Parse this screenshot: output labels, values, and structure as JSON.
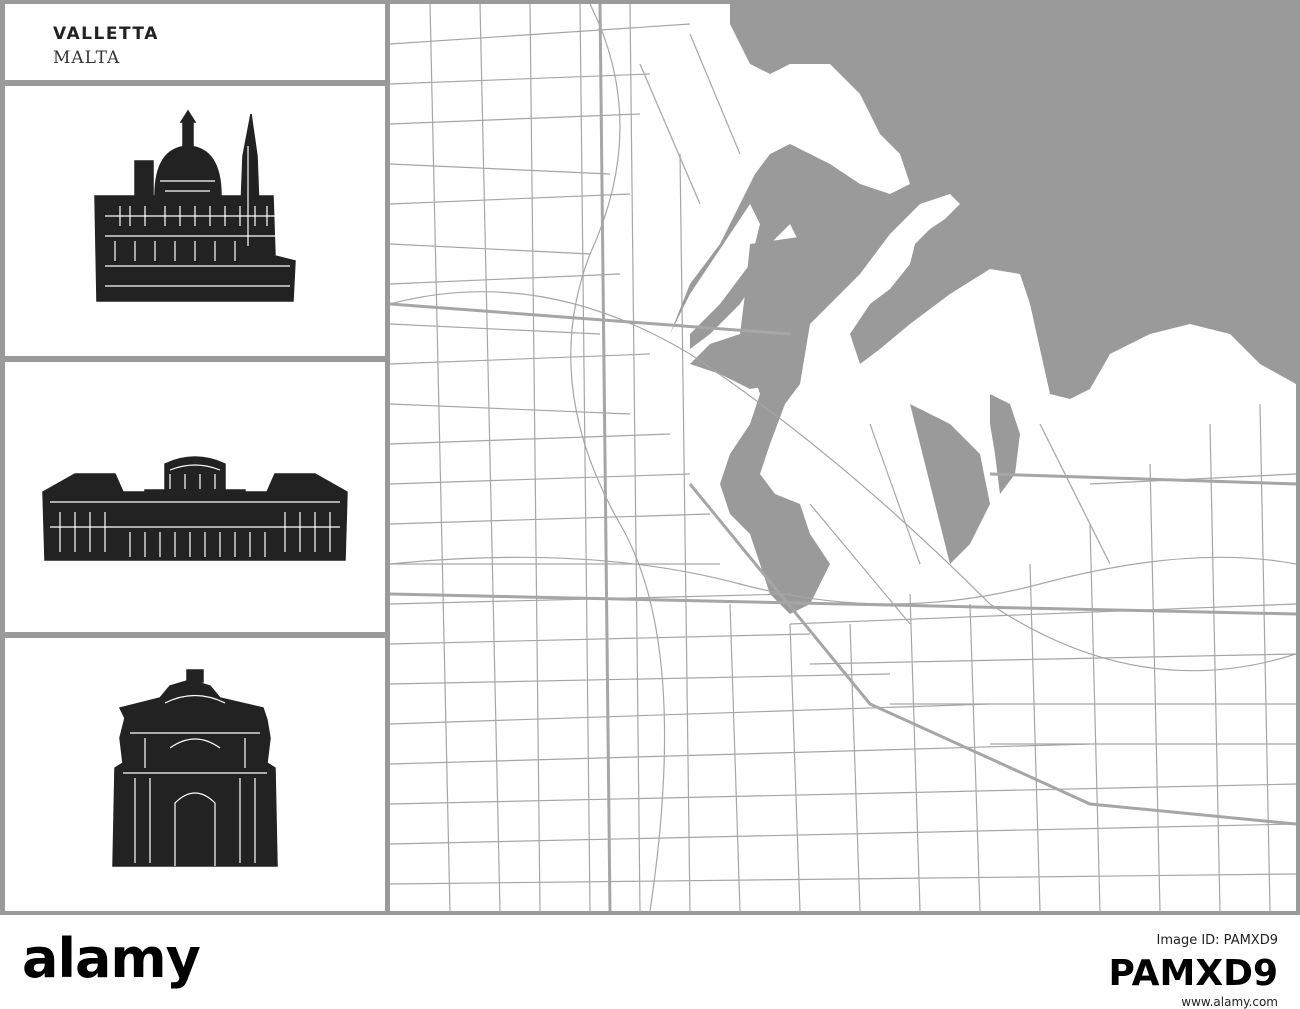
{
  "title": {
    "city": "VALLETTA",
    "country": "MALTA"
  },
  "landmarks": [
    {
      "icon": "cathedral-icon"
    },
    {
      "icon": "palace-icon"
    },
    {
      "icon": "church-facade-icon"
    }
  ],
  "map": {
    "icon": "valletta-street-map",
    "colors": {
      "water": "#9a9a9a",
      "land": "#ffffff",
      "roads": "#a6a6a6",
      "frame": "#9a9a9a"
    }
  },
  "footer": {
    "brand": "alamy",
    "code_line": "Image ID: PAMXD9",
    "code": "PAMXD9",
    "url": "www.alamy.com"
  }
}
